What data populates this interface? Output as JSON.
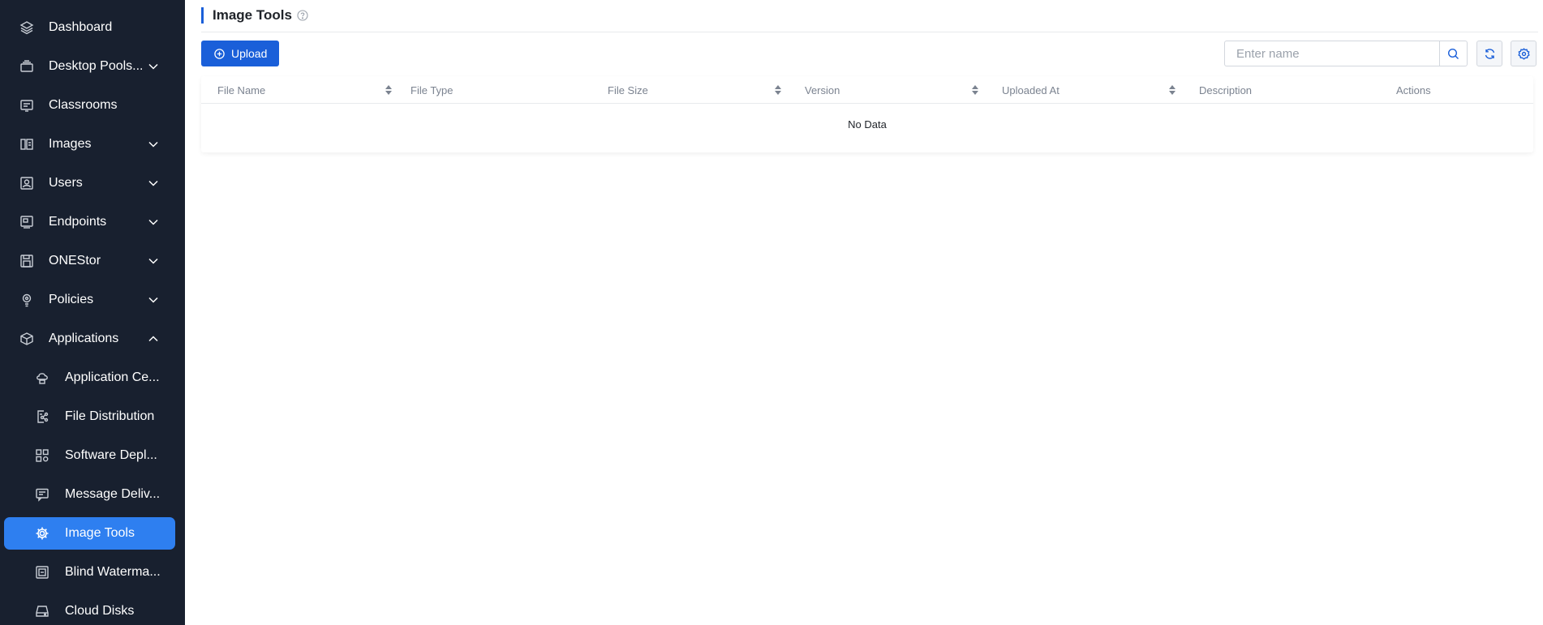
{
  "sidebar": {
    "items": [
      {
        "label": "Dashboard",
        "icon": "layers-icon"
      },
      {
        "label": "Desktop Pools...",
        "icon": "desktop-pools-icon"
      },
      {
        "label": "Classrooms",
        "icon": "classroom-icon"
      },
      {
        "label": "Images",
        "icon": "images-icon"
      },
      {
        "label": "Users",
        "icon": "user-icon"
      },
      {
        "label": "Endpoints",
        "icon": "endpoint-icon"
      },
      {
        "label": "ONEStor",
        "icon": "storage-icon"
      },
      {
        "label": "Policies",
        "icon": "policy-icon"
      },
      {
        "label": "Applications",
        "icon": "box-icon"
      }
    ],
    "sub_items": [
      {
        "label": "Application Ce...",
        "icon": "cloud-app-icon"
      },
      {
        "label": "File Distribution",
        "icon": "share-file-icon"
      },
      {
        "label": "Software Depl...",
        "icon": "software-deploy-icon"
      },
      {
        "label": "Message Deliv...",
        "icon": "message-icon"
      },
      {
        "label": "Image Tools",
        "icon": "gear-icon",
        "active": true
      },
      {
        "label": "Blind Waterma...",
        "icon": "watermark-icon"
      },
      {
        "label": "Cloud Disks",
        "icon": "cloud-disk-icon"
      }
    ]
  },
  "page": {
    "title": "Image Tools",
    "upload_label": "Upload",
    "search_placeholder": "Enter name",
    "empty_text": "No Data"
  },
  "table": {
    "columns": [
      "File Name",
      "File Type",
      "File Size",
      "Version",
      "Uploaded At",
      "Description",
      "Actions"
    ]
  },
  "colors": {
    "sidebar_bg": "#18202f",
    "active_item": "#2e7ff0",
    "primary": "#1a5fd9"
  }
}
